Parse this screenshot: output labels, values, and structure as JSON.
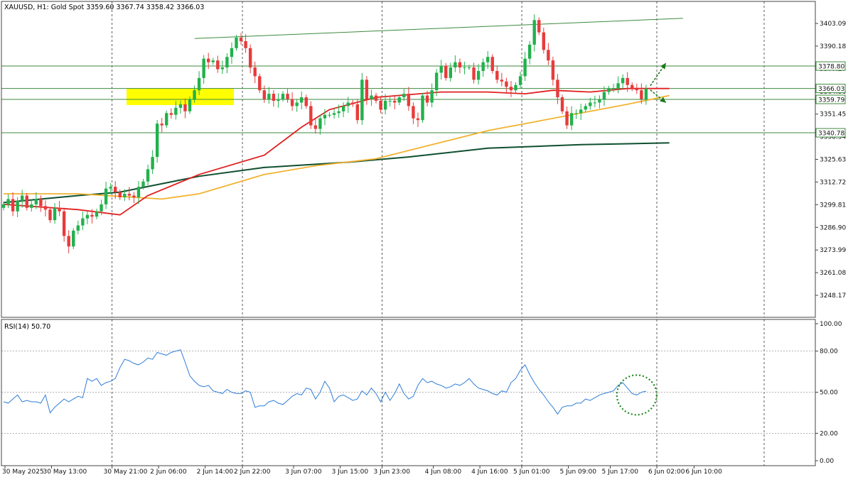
{
  "header": {
    "symbol_label": "XAUUSD, H1:  Gold Spot  3359.60 3367.74 3358.42 3366.03"
  },
  "rsi_label": "RSI(14) 50.70",
  "colors": {
    "bull": "#26a69a",
    "bull_body": "#22b14c",
    "bear": "#e83b3b",
    "ma_fast": "#e02020",
    "ma_mid": "#f2b230",
    "ma_slow": "#0f4f2f",
    "hlines": "#3d8a3d",
    "rsi": "#2f7ed8",
    "highlight": "#ffff00",
    "channel": "#3d8a3d",
    "arrows": "#1d7a1d"
  },
  "chart_data": [
    {
      "type": "candlestick",
      "symbol": "XAUUSD",
      "timeframe": "H1",
      "ylim": [
        3238,
        3418
      ],
      "yticks": [
        3403.09,
        3390.18,
        3377.27,
        3364.36,
        3351.45,
        3338.54,
        3325.63,
        3312.72,
        3299.81,
        3286.9,
        3273.99,
        3261.08,
        3248.17
      ],
      "ytick_labels": [
        "3403.09",
        "3390.18",
        "3377.27",
        "3364.36",
        "3351.45",
        "3338.54",
        "3325.63",
        "3312.72",
        "3299.81",
        "3286.90",
        "3273.99",
        "3261.08",
        "3248.17"
      ],
      "x_labels": [
        "30 May 2025",
        "30 May 13:00",
        "30 May 21:00",
        "2 Jun 06:00",
        "2 Jun 14:00",
        "2 Jun 22:00",
        "3 Jun 07:00",
        "3 Jun 15:00",
        "3 Jun 23:00",
        "4 Jun 08:00",
        "4 Jun 16:00",
        "5 Jun 01:00",
        "5 Jun 09:00",
        "5 Jun 17:00",
        "6 Jun 02:00",
        "6 Jun 10:00"
      ],
      "price_levels": [
        {
          "label": "3378.80",
          "value": 3378.8
        },
        {
          "label": "3366.03",
          "value": 3366.03
        },
        {
          "label": "3359.79",
          "value": 3359.79
        },
        {
          "label": "3340.78",
          "value": 3340.78
        }
      ],
      "channel_line": {
        "start": {
          "bar": 38,
          "value": 3394.5
        },
        "end": {
          "bar": 147,
          "value": 3406.0
        }
      },
      "highlight_zone": {
        "from_bar": 22,
        "to_bar": 40,
        "low": 3359.8,
        "high": 3366.0
      },
      "closes": [
        3300,
        3303,
        3296,
        3302,
        3305,
        3298,
        3300,
        3303,
        3299,
        3297,
        3291,
        3298,
        3296,
        3282,
        3276,
        3285,
        3288,
        3292,
        3294,
        3293,
        3296,
        3300,
        3309,
        3310,
        3307,
        3304,
        3306,
        3305,
        3304,
        3310,
        3313,
        3320,
        3327,
        3346,
        3345,
        3352,
        3351,
        3355,
        3357,
        3353,
        3360,
        3365,
        3372,
        3383,
        3381,
        3382,
        3377,
        3378,
        3384,
        3389,
        3395,
        3393,
        3389,
        3378,
        3373,
        3365,
        3360,
        3363,
        3359,
        3360,
        3363,
        3360,
        3356,
        3358,
        3361,
        3356,
        3345,
        3343,
        3349,
        3351,
        3351,
        3352,
        3353,
        3356,
        3358,
        3357,
        3348,
        3371,
        3360,
        3362,
        3359,
        3354,
        3359,
        3359,
        3358,
        3361,
        3363,
        3356,
        3349,
        3348,
        3362,
        3358,
        3365,
        3375,
        3379,
        3372,
        3378,
        3381,
        3378,
        3378,
        3378,
        3371,
        3376,
        3381,
        3384,
        3376,
        3371,
        3370,
        3367,
        3365,
        3368,
        3373,
        3383,
        3391,
        3405,
        3398,
        3388,
        3382,
        3371,
        3361,
        3353,
        3345,
        3352,
        3352,
        3354,
        3356,
        3358,
        3358,
        3360,
        3364,
        3366,
        3366,
        3369,
        3372,
        3368,
        3366,
        3365,
        3360,
        3366
      ],
      "ma_fast": {
        "start": 3300,
        "waypoints": [
          [
            0,
            3300
          ],
          [
            16,
            3297
          ],
          [
            25,
            3294
          ],
          [
            31,
            3305
          ],
          [
            42,
            3317
          ],
          [
            56,
            3328
          ],
          [
            64,
            3344
          ],
          [
            70,
            3354
          ],
          [
            80,
            3361
          ],
          [
            94,
            3364
          ],
          [
            104,
            3364
          ],
          [
            112,
            3363
          ],
          [
            118,
            3365
          ],
          [
            126,
            3364
          ],
          [
            134,
            3366
          ],
          [
            143,
            3366
          ]
        ]
      },
      "ma_mid": {
        "waypoints": [
          [
            0,
            3306
          ],
          [
            16,
            3306
          ],
          [
            34,
            3303
          ],
          [
            42,
            3306
          ],
          [
            56,
            3317
          ],
          [
            67,
            3322
          ],
          [
            80,
            3326
          ],
          [
            92,
            3334
          ],
          [
            104,
            3342
          ],
          [
            114,
            3347
          ],
          [
            124,
            3352
          ],
          [
            134,
            3357
          ],
          [
            143,
            3362
          ]
        ]
      },
      "ma_slow": {
        "waypoints": [
          [
            0,
            3301
          ],
          [
            16,
            3305
          ],
          [
            25,
            3307
          ],
          [
            42,
            3316
          ],
          [
            56,
            3321
          ],
          [
            74,
            3324
          ],
          [
            87,
            3327
          ],
          [
            104,
            3332
          ],
          [
            124,
            3334
          ],
          [
            143,
            3335
          ]
        ]
      }
    },
    {
      "type": "line",
      "name": "RSI(14)",
      "last_value": 50.7,
      "ylim": [
        0,
        100
      ],
      "yticks": [
        100.0,
        80.0,
        50.0,
        20.0,
        0.0
      ],
      "ytick_labels": [
        "100.00",
        "80.00",
        "50.00",
        "20.00",
        "0.00"
      ],
      "levels": [
        80,
        50,
        20
      ],
      "highlight_circle_around_last": true,
      "values": [
        43,
        42,
        45,
        48,
        43,
        44,
        43,
        43,
        42,
        48,
        35,
        39,
        42,
        45,
        43,
        45,
        47,
        46,
        60,
        58,
        60,
        55,
        57,
        58,
        60,
        68,
        74,
        73,
        71,
        70,
        72,
        75,
        74,
        79,
        78,
        77,
        79,
        80,
        81,
        72,
        62,
        58,
        55,
        54,
        55,
        51,
        50,
        49,
        52,
        50,
        49,
        49,
        51,
        50,
        39,
        40,
        40,
        43,
        44,
        42,
        41,
        44,
        47,
        49,
        48,
        53,
        52,
        45,
        50,
        58,
        53,
        43,
        47,
        48,
        46,
        44,
        45,
        51,
        48,
        53,
        49,
        43,
        50,
        44,
        49,
        56,
        49,
        45,
        47,
        55,
        60,
        57,
        58,
        56,
        55,
        53,
        54,
        56,
        55,
        57,
        60,
        56,
        53,
        52,
        51,
        49,
        48,
        51,
        50,
        57,
        60,
        66,
        70,
        63,
        57,
        52,
        48,
        43,
        39,
        34,
        39,
        40,
        40,
        42,
        42,
        45,
        44,
        46,
        48,
        49,
        50,
        51,
        55,
        57,
        53,
        49,
        48,
        50,
        50.7
      ]
    }
  ]
}
